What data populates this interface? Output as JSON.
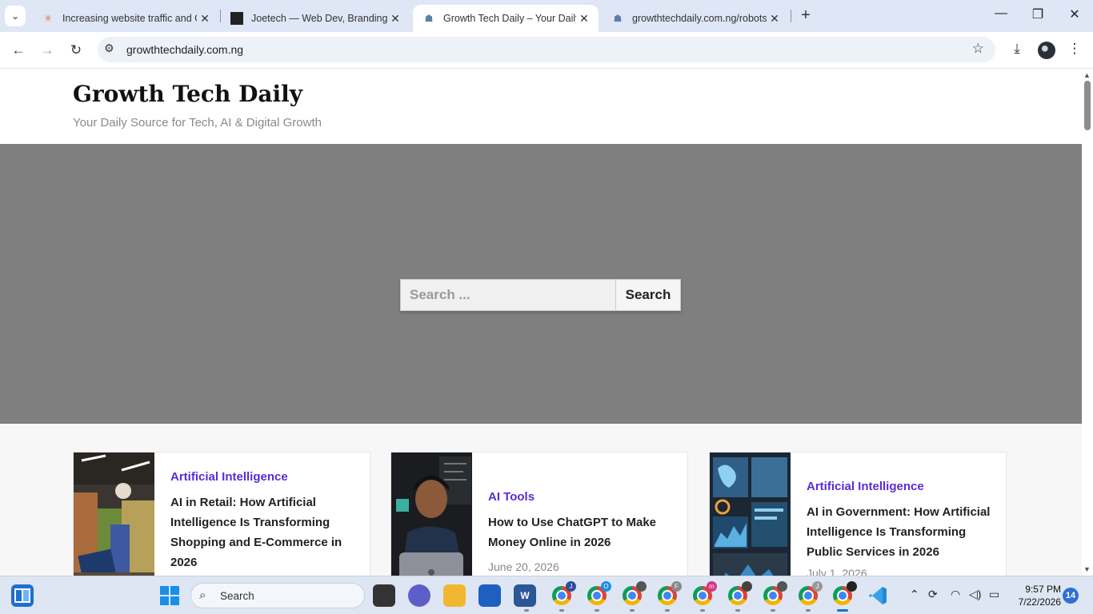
{
  "browser": {
    "tabs": [
      {
        "title": "Increasing website traffic and G",
        "favicon": "claude-icon",
        "active": false
      },
      {
        "title": "Joetech — Web Dev, Branding",
        "favicon": "joetech-icon",
        "active": false
      },
      {
        "title": "Growth Tech Daily – Your Daily",
        "favicon": "site-icon",
        "active": true
      },
      {
        "title": "growthtechdaily.com.ng/robots",
        "favicon": "site-icon",
        "active": false
      }
    ],
    "url": "growthtechdaily.com.ng"
  },
  "site": {
    "title": "Growth Tech Daily",
    "tagline": "Your Daily Source for Tech, AI & Digital Growth"
  },
  "hero": {
    "search_placeholder": "Search ...",
    "search_button": "Search"
  },
  "posts": [
    {
      "category": "Artificial Intelligence",
      "title": "AI in Retail: How Artificial Intelligence Is Transforming Shopping and E-Commerce in 2026",
      "date": ""
    },
    {
      "category": "AI Tools",
      "title": "How to Use ChatGPT to Make Money Online in 2026",
      "date": "June 20, 2026"
    },
    {
      "category": "Artificial Intelligence",
      "title": "AI in Government: How Artificial Intelligence Is Transforming Public Services in 2026",
      "date": "July 1, 2026"
    }
  ],
  "taskbar": {
    "search_label": "Search",
    "time": "9:57 PM",
    "date": "7/22/2026",
    "notifications": "14",
    "chrome_badges": [
      "J",
      "O",
      "",
      "F",
      "m",
      "",
      "",
      "J",
      ""
    ]
  },
  "colors": {
    "accent": "#5a2bd6",
    "hero_bg": "#7f7f7f",
    "tabstrip_bg": "#dfe6f5"
  }
}
